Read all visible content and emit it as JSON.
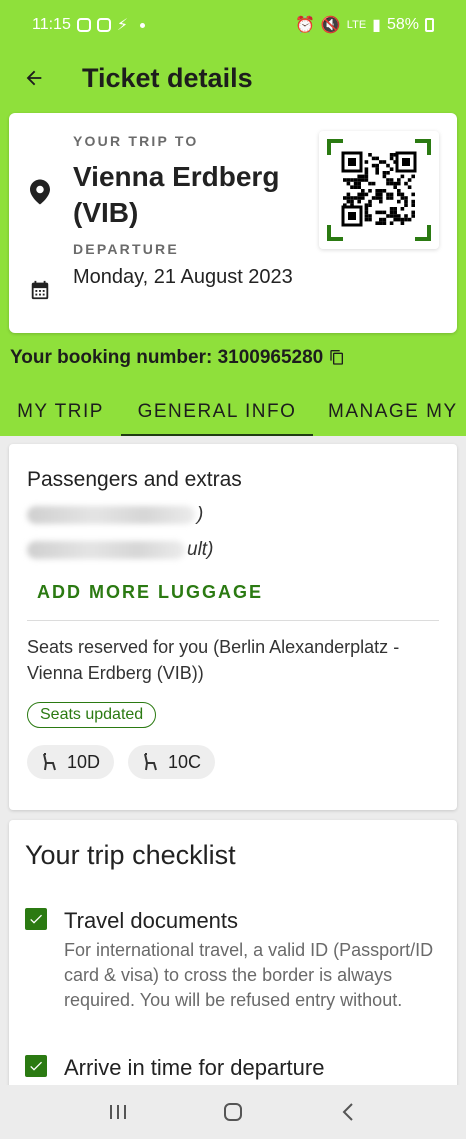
{
  "status_bar": {
    "time": "11:15",
    "network": "LTE",
    "battery": "58%"
  },
  "app_bar": {
    "title": "Ticket details",
    "back_icon": "arrow-left-icon"
  },
  "trip": {
    "trip_label": "YOUR TRIP TO",
    "destination": "Vienna Erdberg (VIB)",
    "departure_label": "DEPARTURE",
    "departure_date": "Monday, 21 August 2023"
  },
  "booking": {
    "label": "Your booking number: 3100965280",
    "copy_icon": "copy-icon"
  },
  "tabs": [
    {
      "label": "MY TRIP",
      "active": false
    },
    {
      "label": "GENERAL INFO",
      "active": true
    },
    {
      "label": "MANAGE MY",
      "active": false
    }
  ],
  "passengers": {
    "title": "Passengers and extras",
    "row1_tail": ")",
    "row2_tail": "ult)",
    "add_luggage": "ADD MORE LUGGAGE",
    "seats_text": "Seats reserved for you (Berlin Alexanderplatz - Vienna Erdberg (VIB))",
    "seats_badge": "Seats updated",
    "seats": [
      "10D",
      "10C"
    ]
  },
  "checklist": {
    "title": "Your trip checklist",
    "items": [
      {
        "title": "Travel documents",
        "description": "For international travel, a valid ID (Passport/ID card & visa) to cross the border is always required. You will be refused entry without.",
        "checked": true
      },
      {
        "title": "Arrive in time for departure",
        "checked": true
      }
    ]
  },
  "colors": {
    "header_green": "#8fe03b",
    "accent_green": "#2b7a12",
    "qr_corner_green": "#2b7a12"
  }
}
